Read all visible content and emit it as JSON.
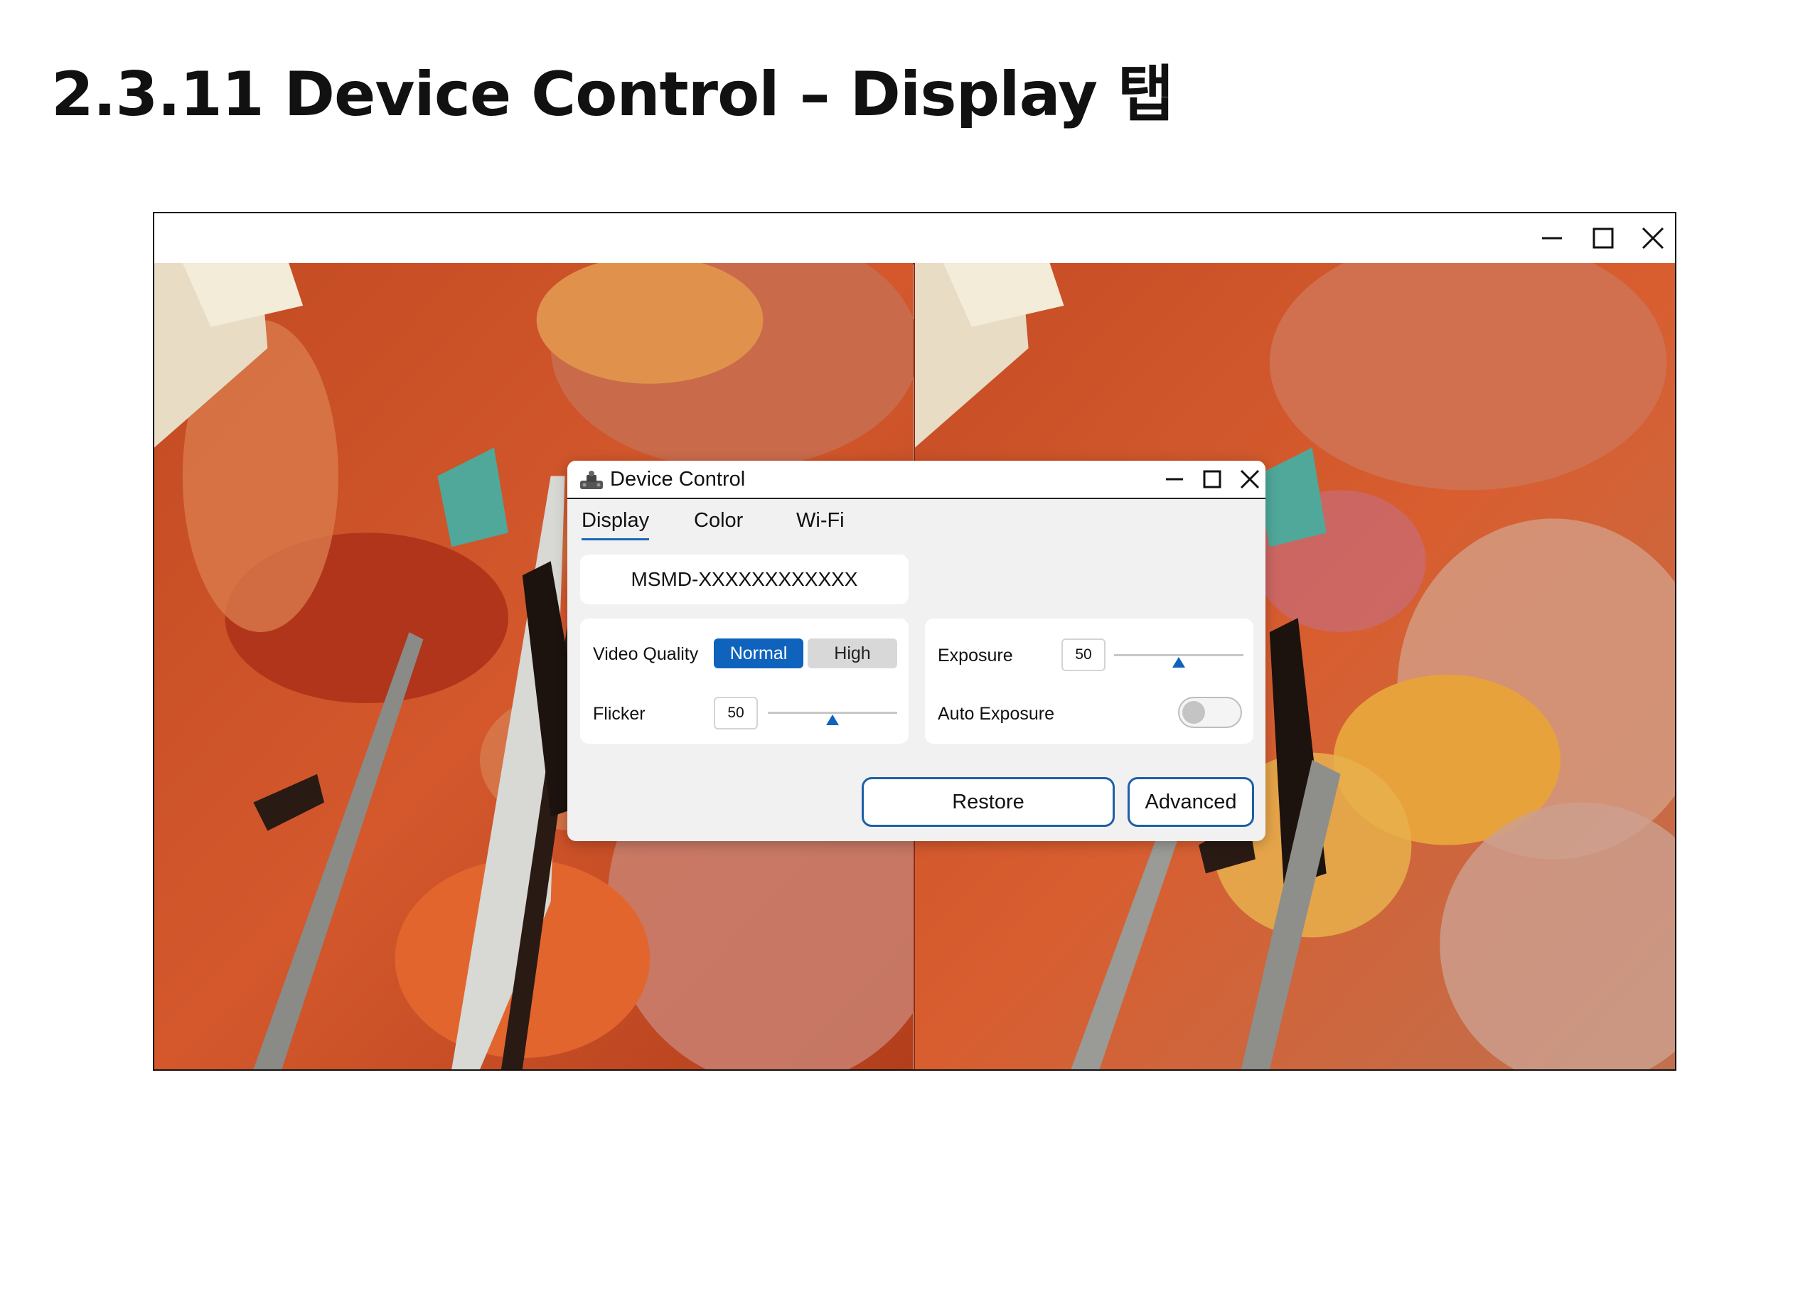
{
  "page": {
    "title": "2.3.11 Device Control – Display 탭"
  },
  "main_window": {
    "controls": [
      "minimize-icon",
      "maximize-icon",
      "close-icon"
    ]
  },
  "dialog": {
    "title": "Device Control",
    "icon": "device-icon",
    "tabs": [
      {
        "label": "Display",
        "active": true
      },
      {
        "label": "Color",
        "active": false
      },
      {
        "label": "Wi-Fi",
        "active": false
      }
    ],
    "device_id": "MSMD-XXXXXXXXXXXX",
    "video_quality": {
      "label": "Video Quality",
      "options": [
        "Normal",
        "High"
      ],
      "selected": "Normal"
    },
    "flicker": {
      "label": "Flicker",
      "value": "50",
      "fraction": 0.5
    },
    "exposure": {
      "label": "Exposure",
      "value": "50",
      "fraction": 0.5
    },
    "auto_exposure": {
      "label": "Auto Exposure",
      "enabled": false
    },
    "buttons": {
      "restore": "Restore",
      "advanced": "Advanced"
    },
    "accent_color": "#0f63bd",
    "button_border_color": "#1e5fa8"
  }
}
